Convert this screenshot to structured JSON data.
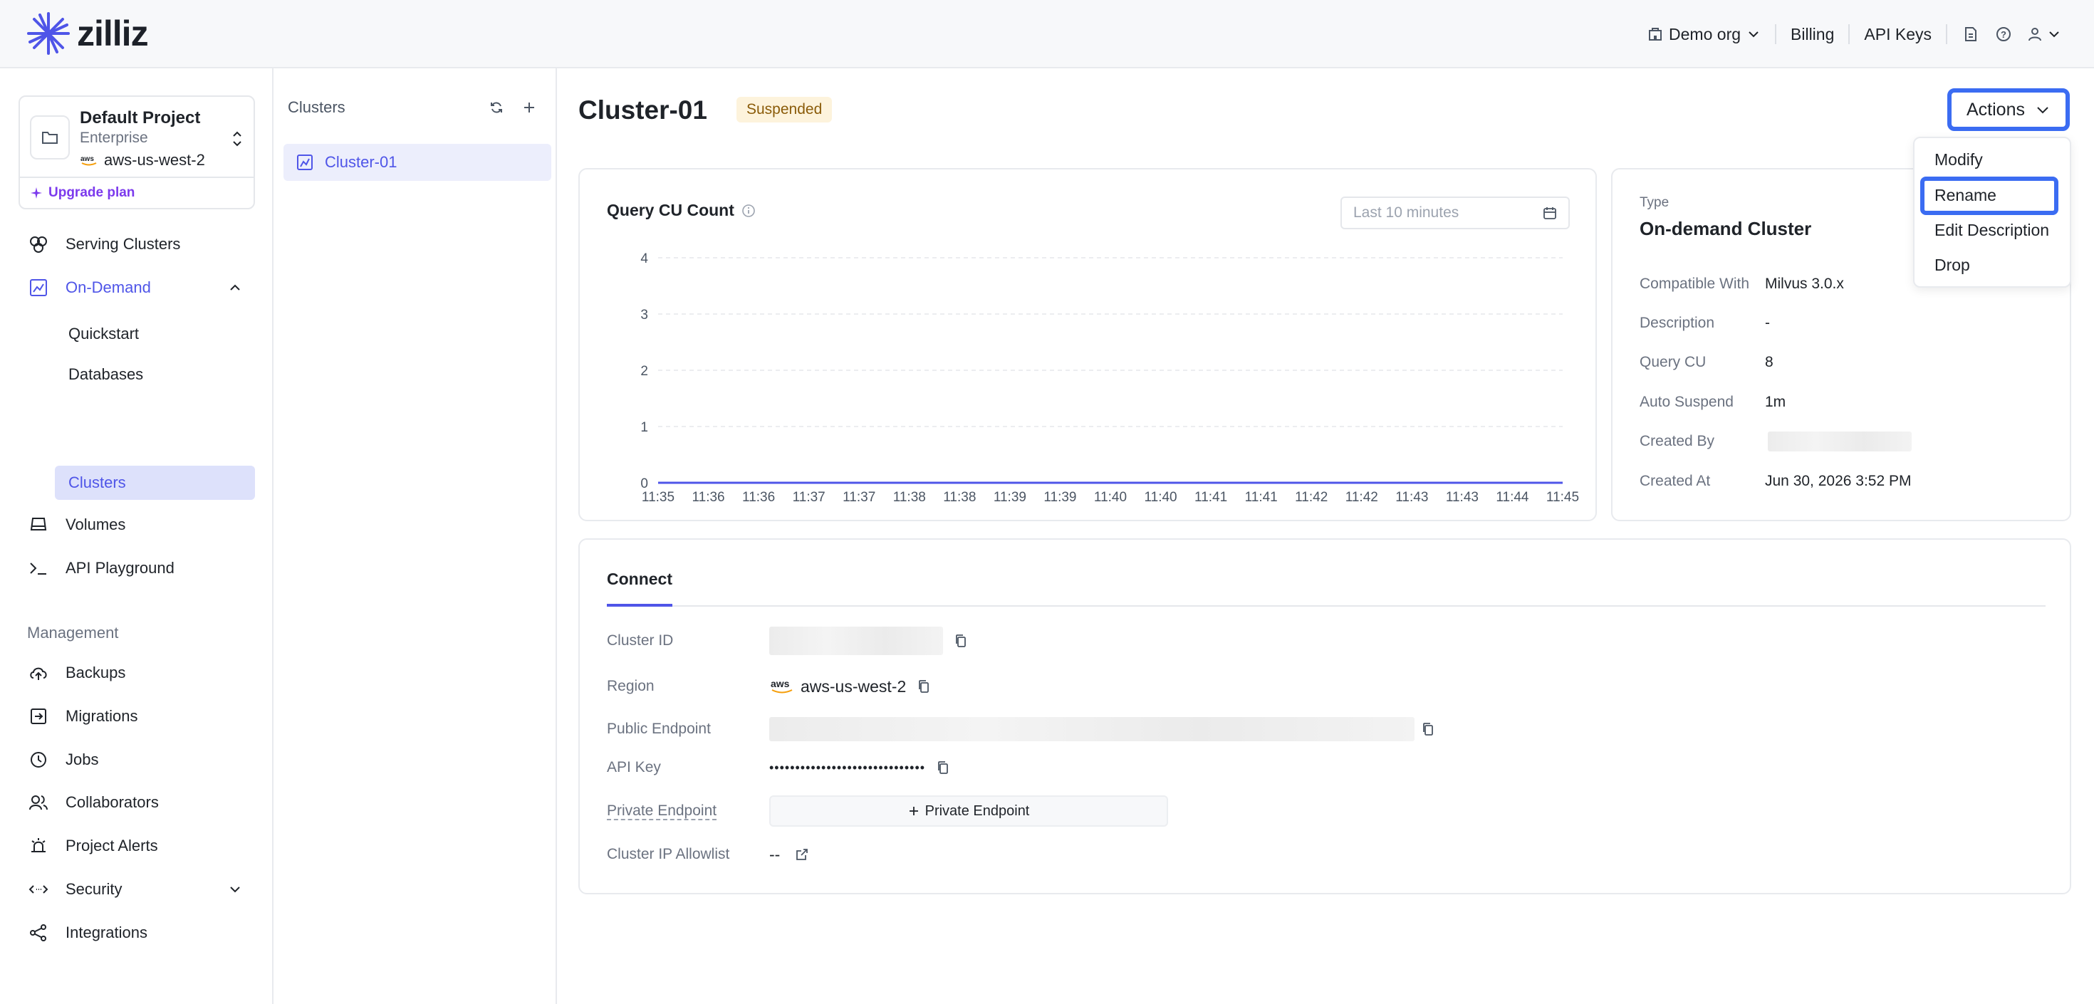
{
  "header": {
    "brand": "zilliz",
    "org": "Demo org",
    "billing": "Billing",
    "api_keys": "API Keys"
  },
  "project": {
    "name": "Default Project",
    "tier": "Enterprise",
    "region": "aws-us-west-2",
    "upgrade": "Upgrade plan"
  },
  "sidebar": {
    "serving_clusters": "Serving Clusters",
    "on_demand": "On-Demand",
    "sub": [
      "Quickstart",
      "Databases",
      "Clusters"
    ],
    "volumes": "Volumes",
    "api_playground": "API Playground",
    "management_label": "Management",
    "management": [
      "Backups",
      "Migrations",
      "Jobs",
      "Collaborators",
      "Project Alerts",
      "Security",
      "Integrations"
    ]
  },
  "clusters_panel": {
    "title": "Clusters",
    "items": [
      "Cluster-01"
    ]
  },
  "main": {
    "title": "Cluster-01",
    "status": "Suspended",
    "actions_label": "Actions"
  },
  "actions_menu": {
    "items": [
      "Modify",
      "Rename",
      "Edit Description",
      "Drop"
    ],
    "highlighted": "Rename"
  },
  "chart": {
    "time_range_placeholder": "Last 10 minutes"
  },
  "chart_data": {
    "type": "line",
    "title": "Query CU Count",
    "x": [
      "11:35",
      "11:36",
      "11:36",
      "11:37",
      "11:37",
      "11:38",
      "11:38",
      "11:39",
      "11:39",
      "11:40",
      "11:40",
      "11:41",
      "11:41",
      "11:42",
      "11:42",
      "11:43",
      "11:43",
      "11:44",
      "11:45"
    ],
    "series": [
      {
        "values": [
          0,
          0,
          0,
          0,
          0,
          0,
          0,
          0,
          0,
          0,
          0,
          0,
          0,
          0,
          0,
          0,
          0,
          0,
          0
        ],
        "color": "#4f55e8"
      }
    ],
    "yticks": [
      0,
      1,
      2,
      3,
      4
    ],
    "ylim": [
      0,
      4
    ],
    "grid": true
  },
  "details": {
    "type_label": "Type",
    "type_value": "On-demand Cluster",
    "rows": [
      {
        "key": "Compatible With",
        "value": "Milvus 3.0.x"
      },
      {
        "key": "Description",
        "value": "-"
      },
      {
        "key": "Query CU",
        "value": "8"
      },
      {
        "key": "Auto Suspend",
        "value": "1m"
      },
      {
        "key": "Created By",
        "value": ""
      },
      {
        "key": "Created At",
        "value": "Jun 30, 2026 3:52 PM"
      }
    ]
  },
  "connect": {
    "tab": "Connect",
    "cluster_id_label": "Cluster ID",
    "region_label": "Region",
    "region_value": "aws-us-west-2",
    "public_endpoint_label": "Public Endpoint",
    "api_key_label": "API Key",
    "api_key_value": "••••••••••••••••••••••••••••••",
    "private_endpoint_label": "Private Endpoint",
    "private_endpoint_button": "Private Endpoint",
    "ip_allowlist_label": "Cluster IP Allowlist",
    "ip_allowlist_value": "--"
  },
  "colors": {
    "accent": "#4f55e8",
    "focus_ring": "#3b6cf2",
    "suspended_bg": "#fdf3dc",
    "suspended_text": "#8a5b09"
  }
}
